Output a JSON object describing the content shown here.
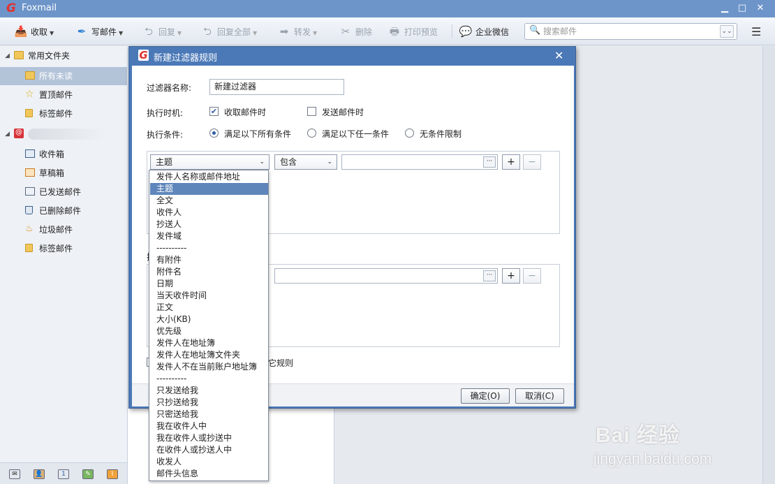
{
  "app": {
    "title": "Foxmail"
  },
  "window": {
    "minimize": "▁",
    "maximize": "□",
    "close": "✕"
  },
  "toolbar": {
    "receive": "收取",
    "compose": "写邮件",
    "reply": "回复",
    "reply_all": "回复全部",
    "forward": "转发",
    "delete": "删除",
    "print_preview": "打印预览",
    "wecom": "企业微信",
    "search_placeholder": "搜索邮件"
  },
  "sidebar": {
    "common_folders": "常用文件夹",
    "items_common": [
      "所有未读",
      "置顶邮件",
      "标签邮件"
    ],
    "account_items": [
      "收件箱",
      "草稿箱",
      "已发送邮件",
      "已删除邮件",
      "垃圾邮件",
      "标签邮件"
    ]
  },
  "dialog": {
    "title": "新建过滤器规则",
    "name_label": "过滤器名称:",
    "name_value": "新建过滤器",
    "timing_label": "执行时机:",
    "on_receive": "收取邮件时",
    "on_send": "发送邮件时",
    "condition_label": "执行条件:",
    "cond_all": "满足以下所有条件",
    "cond_any": "满足以下任一条件",
    "cond_none": "无条件限制",
    "field_select": "主题",
    "op_select": "包含",
    "dots": "···",
    "add": "+",
    "remove": "−",
    "action_label_partial": "执",
    "stop_rules_partial": "它规则",
    "ok": "确定(O)",
    "cancel": "取消(C)"
  },
  "dropdown": {
    "options": [
      "发件人名称或邮件地址",
      "主题",
      "全文",
      "收件人",
      "抄送人",
      "发件域",
      "----------",
      "有附件",
      "附件名",
      "日期",
      "当天收件时间",
      "正文",
      "大小(KB)",
      "优先级",
      "发件人在地址簿",
      "发件人在地址簿文件夹",
      "发件人不在当前账户地址簿",
      "----------",
      "只发送给我",
      "只抄送给我",
      "只密送给我",
      "我在收件人中",
      "我在收件人或抄送中",
      "在收件人或抄送人中",
      "收发人",
      "邮件头信息"
    ],
    "selected": "主题"
  },
  "watermark": {
    "text": "Bai 经验",
    "url": "jingyan.baidu.com"
  }
}
